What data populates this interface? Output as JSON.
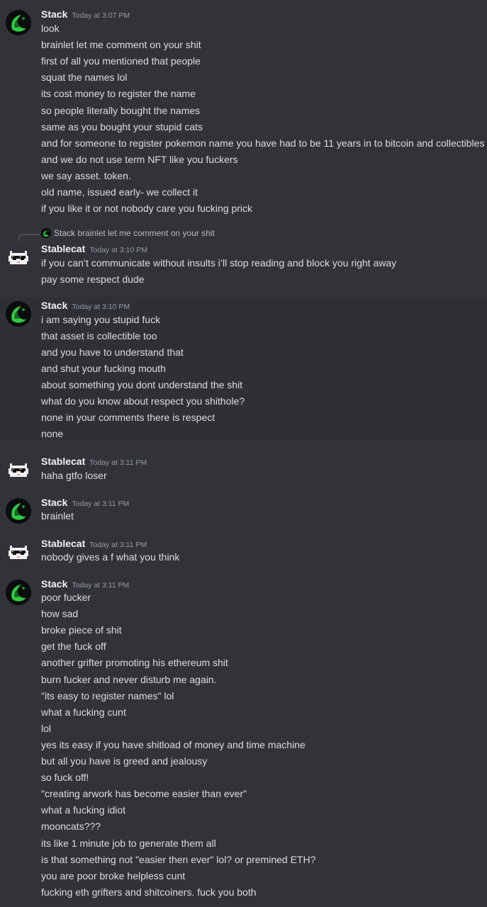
{
  "messages": [
    {
      "author": "Stack",
      "time": "Today at 3:07 PM",
      "lines": [
        "look",
        "brainlet let me comment on your shit",
        "first of all you mentioned that people",
        "squat the names lol",
        "its cost money to register the name",
        "so people literally bought the names",
        "same as you bought your stupid cats",
        "and for someone to register pokemon name you have had to be 11 years in to bitcoin and collectibles",
        "and we do not use term NFT like you fuckers",
        "we say asset. token.",
        "old name, issued early- we collect it",
        "if you like it or not nobody care you fucking prick"
      ]
    },
    {
      "author": "Stablecat",
      "time": "Today at 3:10 PM",
      "reply": {
        "author": "Stack",
        "text": "brainlet let me comment on your shit"
      },
      "lines": [
        "if you can’t communicate without insults i’ll stop reading and block you right away",
        "pay some respect dude"
      ]
    },
    {
      "author": "Stack",
      "time": "Today at 3:10 PM",
      "lines": [
        "i am saying you stupid fuck",
        "that asset is collectible too",
        "and you have to understand that",
        "and shut your fucking mouth",
        "about something you dont understand the shit",
        "what do you know about respect you shithole?",
        "none in your comments there is respect",
        "none"
      ]
    },
    {
      "author": "Stablecat",
      "time": "Today at 3:11 PM",
      "lines": [
        "haha gtfo loser"
      ]
    },
    {
      "author": "Stack",
      "time": "Today at 3:11 PM",
      "lines": [
        "brainlet"
      ]
    },
    {
      "author": "Stablecat",
      "time": "Today at 3:11 PM",
      "lines": [
        "nobody gives a f what you think"
      ]
    },
    {
      "author": "Stack",
      "time": "Today at 3:11 PM",
      "lines": [
        "poor fucker",
        "how sad",
        "broke piece of shit",
        "get the fuck off",
        "another grifter promoting his ethereum shit",
        "burn fucker and never disturb me again.",
        "\"its easy to register names\" lol",
        "what a fucking cunt",
        "lol",
        "yes its easy if you have shitload of money and time machine",
        "but all you have is greed and jealousy",
        "so fuck off!",
        "\"creating arwork has become easier than ever\"",
        "what a fucking idiot",
        "mooncats???",
        "its like 1 minute job to generate them all",
        "is that something not \"easier then ever\" lol? or premined ETH?",
        "you are poor broke helpless cunt",
        "fucking eth grifters and shitcoiners. fuck you both"
      ]
    }
  ],
  "colors": {
    "background": "#313338",
    "text": "#dbdee1",
    "author": "#f2f3f5",
    "timestamp": "#949ba4",
    "stack_avatar_accent": "#2ecc40"
  }
}
